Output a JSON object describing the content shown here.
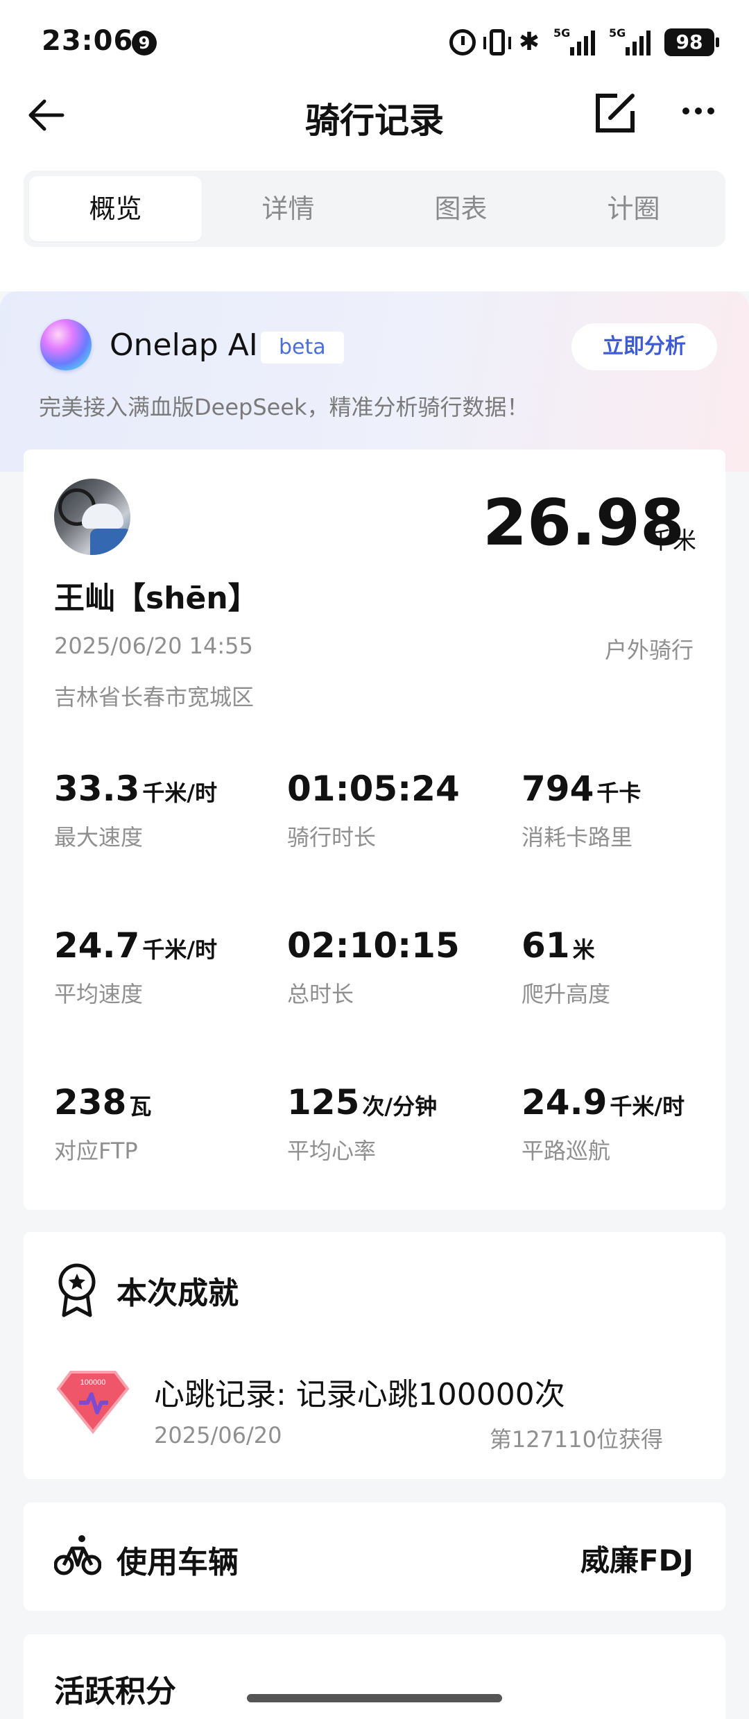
{
  "status_bar": {
    "time": "23:06",
    "notification_count": "9",
    "network_tag_1": "5G",
    "network_tag_2": "5G",
    "battery": "98"
  },
  "header": {
    "title": "骑行记录"
  },
  "tabs": [
    {
      "label": "概览",
      "active": true
    },
    {
      "label": "详情",
      "active": false
    },
    {
      "label": "图表",
      "active": false
    },
    {
      "label": "计圈",
      "active": false
    }
  ],
  "ai_banner": {
    "name": "Onelap AI",
    "badge": "beta",
    "button": "立即分析",
    "description": "完美接入满血版DeepSeek，精准分析骑行数据！"
  },
  "ride": {
    "distance": "26.98",
    "distance_unit": "千米",
    "rider_name": "王屾【shēn】",
    "datetime": "2025/06/20 14:55",
    "type": "户外骑行",
    "location": "吉林省长春市宽城区",
    "stats": [
      {
        "value": "33.3",
        "unit": "千米/时",
        "label": "最大速度"
      },
      {
        "value": "01:05:24",
        "unit": "",
        "label": "骑行时长"
      },
      {
        "value": "794",
        "unit": "千卡",
        "label": "消耗卡路里"
      },
      {
        "value": "24.7",
        "unit": "千米/时",
        "label": "平均速度"
      },
      {
        "value": "02:10:15",
        "unit": "",
        "label": "总时长"
      },
      {
        "value": "61",
        "unit": "米",
        "label": "爬升高度"
      },
      {
        "value": "238",
        "unit": "瓦",
        "label": "对应FTP"
      },
      {
        "value": "125",
        "unit": "次/分钟",
        "label": "平均心率"
      },
      {
        "value": "24.9",
        "unit": "千米/时",
        "label": "平路巡航"
      }
    ]
  },
  "achievement": {
    "section_title": "本次成就",
    "name": "心跳记录: 记录心跳100000次",
    "badge_text": "100000",
    "date": "2025/06/20",
    "rank": "第127110位获得"
  },
  "vehicle": {
    "section_title": "使用车辆",
    "name": "威廉FDJ"
  },
  "points": {
    "section_title": "活跃积分"
  },
  "colors": {
    "accent_blue": "#3d5bd6",
    "badge_red": "#f0566a",
    "muted_text": "#8f8f8f"
  }
}
